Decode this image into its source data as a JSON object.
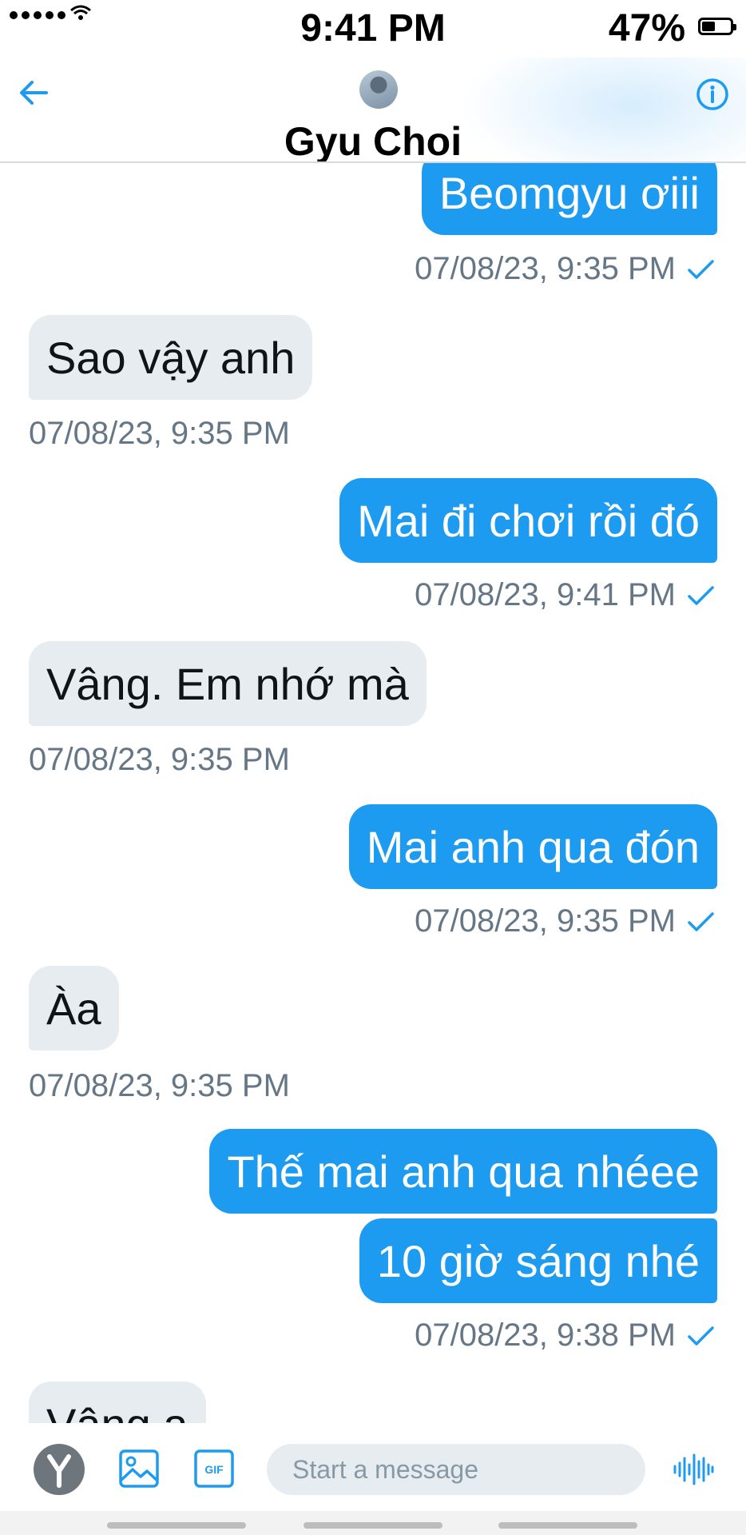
{
  "status_bar": {
    "time": "9:41 PM",
    "battery": "47%",
    "battery_level": 0.47
  },
  "header": {
    "contact_name": "Gyu Choi"
  },
  "colors": {
    "accent": "#1d9bf0",
    "incoming_bubble": "#e6ecf0",
    "meta_text": "#657786"
  },
  "messages": [
    {
      "direction": "out",
      "text": "Beomgyu ơiii",
      "time": "07/08/23, 9:35 PM",
      "read": true
    },
    {
      "direction": "in",
      "text": "Sao vậy anh",
      "time": "07/08/23, 9:35 PM"
    },
    {
      "direction": "out",
      "text": "Mai đi chơi rồi đó",
      "time": "07/08/23, 9:41 PM",
      "read": true
    },
    {
      "direction": "in",
      "text": "Vâng. Em nhớ mà",
      "time": "07/08/23, 9:35 PM"
    },
    {
      "direction": "out",
      "text": "Mai anh qua đón",
      "time": "07/08/23, 9:35 PM",
      "read": true
    },
    {
      "direction": "in",
      "text": "Àa",
      "time": "07/08/23, 9:35 PM"
    },
    {
      "direction": "out",
      "text": "Thế mai anh qua nhéee"
    },
    {
      "direction": "out",
      "text": "10 giờ sáng nhé",
      "time": "07/08/23, 9:38 PM",
      "read": true
    },
    {
      "direction": "in",
      "text": "Vâng ạ"
    }
  ],
  "composer": {
    "placeholder": "Start a message",
    "icons": [
      "y-avatar-icon",
      "image-icon",
      "gif-icon",
      "voice-message-icon"
    ]
  },
  "gif_label": "GIF"
}
